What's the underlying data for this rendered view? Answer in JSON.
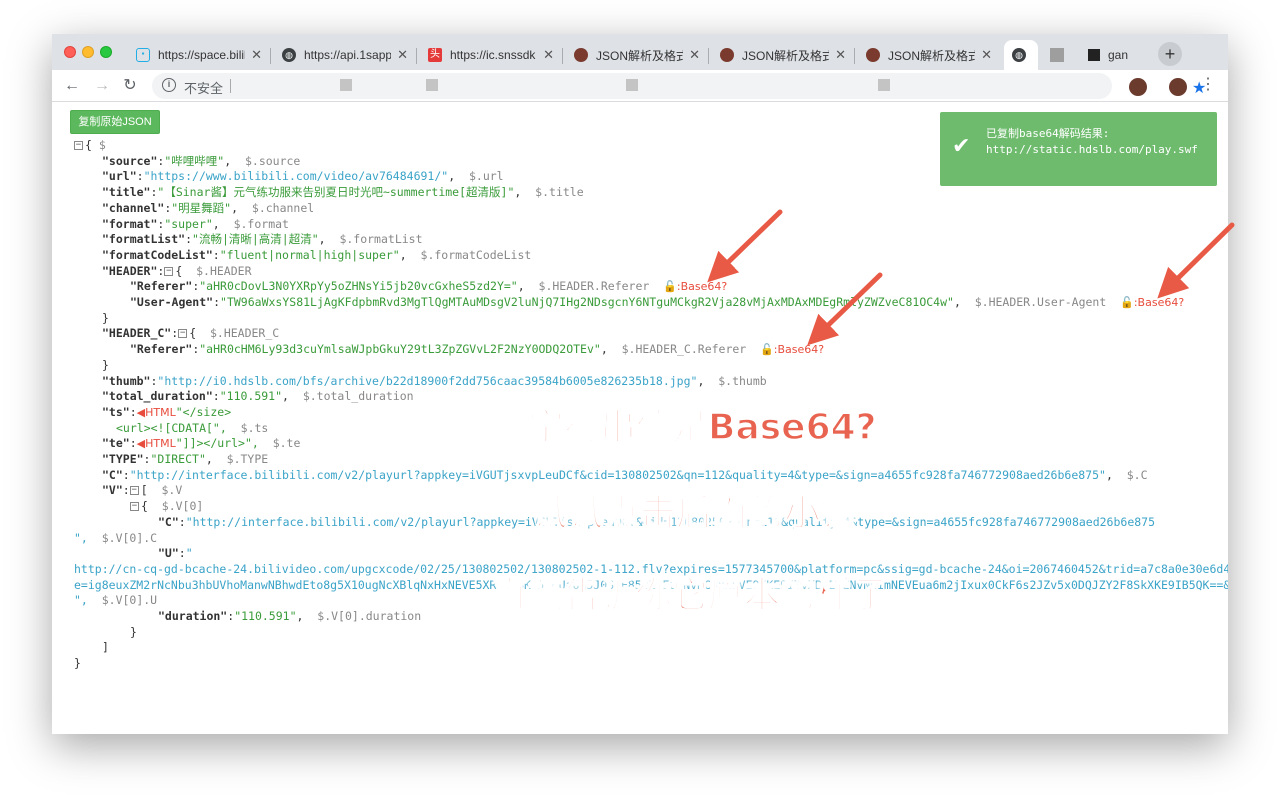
{
  "tabs": [
    {
      "title": "https://space.bilibi",
      "icon": "bilibili-icon"
    },
    {
      "title": "https://api.1sapp",
      "icon": "globe-icon"
    },
    {
      "title": "https://ic.snssdk",
      "icon": "toutiao-icon"
    },
    {
      "title": "JSON解析及格式",
      "icon": "eye-icon"
    },
    {
      "title": "JSON解析及格式",
      "icon": "eye-icon"
    },
    {
      "title": "JSON解析及格式",
      "icon": "eye-icon"
    },
    {
      "title": "",
      "icon": "globe-icon"
    },
    {
      "title": "",
      "icon": "gray-square-icon"
    },
    {
      "title": "gan",
      "icon": "black-square-icon"
    }
  ],
  "omnibox": {
    "security": "不安全"
  },
  "copy_button": "复制原始JSON",
  "toast": {
    "line1": "已复制base64解码结果:",
    "line2": "http://static.hdslb.com/play.swf"
  },
  "json": {
    "root_path": "$",
    "source_key": "\"source\"",
    "source_val": "\"哔哩哔哩\"",
    "source_path": "$.source",
    "url_key": "\"url\"",
    "url_val": "\"https://www.bilibili.com/video/av76484691/\"",
    "url_path": "$.url",
    "title_key": "\"title\"",
    "title_val": "\"【Sinar酱】元气练功服来告别夏日时光吧~summertime[超清版]\"",
    "title_path": "$.title",
    "channel_key": "\"channel\"",
    "channel_val": "\"明星舞蹈\"",
    "channel_path": "$.channel",
    "format_key": "\"format\"",
    "format_val": "\"super\"",
    "format_path": "$.format",
    "formatList_key": "\"formatList\"",
    "formatList_val": "\"流畅|清晰|高清|超清\"",
    "formatList_path": "$.formatList",
    "formatCodeList_key": "\"formatCodeList\"",
    "formatCodeList_val": "\"fluent|normal|high|super\"",
    "formatCodeList_path": "$.formatCodeList",
    "header_key": "\"HEADER\"",
    "header_path": "$.HEADER",
    "referer_key": "\"Referer\"",
    "referer_val": "\"aHR0cDovL3N0YXRpYy5oZHNsYi5jb20vcGxheS5zd2Y=\"",
    "referer_path": "$.HEADER.Referer",
    "ua_key": "\"User-Agent\"",
    "ua_val": "\"TW96aWxsYS81LjAgKFdpbmRvd3MgTlQgMTAuMDsgV2luNjQ7IHg2NDsgcnY6NTguMCkgR2Vja28vMjAxMDAxMDEgRmlyZWZveC81OC4w\"",
    "ua_path": "$.HEADER.User-Agent",
    "headerc_key": "\"HEADER_C\"",
    "headerc_path": "$.HEADER_C",
    "refererc_key": "\"Referer\"",
    "refererc_val": "\"aHR0cHM6Ly93d3cuYmlsaWJpbGkuY29tL3ZpZGVvL2F2NzY0ODQ2OTEv\"",
    "refererc_path": "$.HEADER_C.Referer",
    "thumb_key": "\"thumb\"",
    "thumb_val": "\"http://i0.hdslb.com/bfs/archive/b22d18900f2dd756caac39584b6005e826235b18.jpg\"",
    "thumb_path": "$.thumb",
    "dur_key": "\"total_duration\"",
    "dur_val": "\"110.591\"",
    "dur_path": "$.total_duration",
    "ts_key": "\"ts\"",
    "ts_html": "HTML",
    "ts_tail": "\"</size>",
    "ts_line2": "<url><![CDATA[\",",
    "ts_path": "$.ts",
    "te_key": "\"te\"",
    "te_html": "HTML",
    "te_tail": "\"]]></url>\",",
    "te_path": "$.te",
    "type_key": "\"TYPE\"",
    "type_val": "\"DIRECT\"",
    "type_path": "$.TYPE",
    "c_key": "\"C\"",
    "c_val": "\"http://interface.bilibili.com/v2/playurl?appkey=iVGUTjsxvpLeuDCf&cid=130802502&qn=112&quality=4&type=&sign=a4655fc928fa746772908aed26b6e875\"",
    "c_path": "$.C",
    "v_key": "\"V\"",
    "v_path": "$.V",
    "v0_path": "$.V[0]",
    "vc_key": "\"C\"",
    "vc_val": "\"http://interface.bilibili.com/v2/playurl?appkey=iVGUTjsxvpLeuDCf&cid=130802502&qn=112&quality=4&type=&sign=a4655fc928fa746772908aed26b6e875",
    "vc_tail": "\",",
    "vc_path": "$.V[0].C",
    "vu_key": "\"U\"",
    "vu_open": "\"",
    "vu_val1": "http://cn-cq-gd-bcache-24.bilivideo.com/upgcxcode/02/25/130802502/130802502-1-112.flv?expires=1577345700&platform=pc&ssig=gd-bcache-24&oi=2067460452&trid=a7c8a0e30e6d4a1c8f1c4a8a2a4d0c3a&nfc=1&nfb=maPYqpoel5MI3qOUX6YpRA==&mid=0&logo=80000000",
    "vu_val2": "e=ig8euxZM2rNcNbu3hbUVhoManwNBhwdEto8g5X10ugNcXBlqNxHxNEVE5XREto8KqJZHUa6m5J0SqE85tZvEuENvNC8xNEVE9EKE9IMvXBvEuENvNCImNEVEua6m2jIxux0CkF6s2JZv5x0DQJZY2F8SkXKE9IB5QK==&bvc=vod&nettype=0&orderid=0,2&agrr=0&bw=49318&upsig=aXRE9IMvXBvEuENvNCImNEVEua6",
    "vu_tail": "\",",
    "vu_path": "$.V[0].U",
    "vd_key": "\"duration\"",
    "vd_val": "\"110.591\"",
    "vd_path": "$.V[0].duration",
    "base64_tag": ":Base64?"
  },
  "overlay": {
    "line1": "字符串值是Base64?",
    "line2": "试试点击后面的小锁",
    "line3": "直接告诉你它原本的样子"
  },
  "colors": {
    "toast_bg": "#6ebb6e",
    "button_bg": "#5cb85c",
    "overlay_text": "#e86450",
    "arrow": "#e85a45",
    "string": "#3a9b3a",
    "url": "#3aa3c8"
  }
}
